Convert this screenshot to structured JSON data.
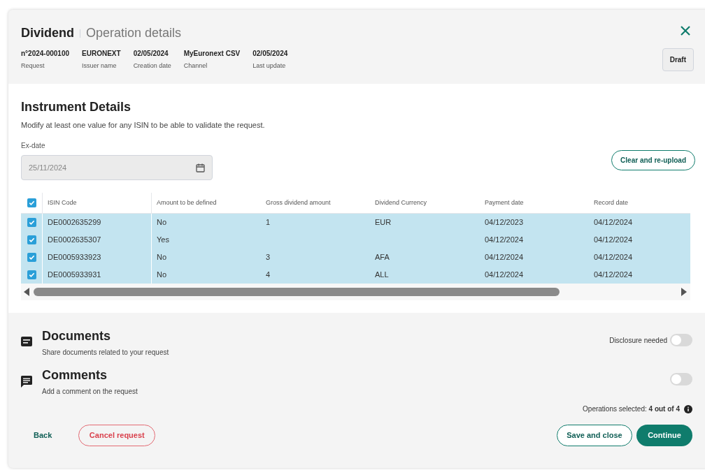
{
  "header": {
    "title": "Dividend",
    "subtitle": "Operation details",
    "status": "Draft",
    "meta": [
      {
        "value": "n°2024-000100",
        "label": "Request"
      },
      {
        "value": "EURONEXT",
        "label": "Issuer name"
      },
      {
        "value": "02/05/2024",
        "label": "Creation date"
      },
      {
        "value": "MyEuronext CSV",
        "label": "Channel"
      },
      {
        "value": "02/05/2024",
        "label": "Last update"
      }
    ]
  },
  "instrument": {
    "title": "Instrument Details",
    "description": "Modify at least one value for any ISIN to be able to validate the request.",
    "ex_date": {
      "label": "Ex-date",
      "value": "25/11/2024",
      "disabled": true
    },
    "clear_button": "Clear and re-upload"
  },
  "table": {
    "all_checked": true,
    "columns": [
      "ISIN Code",
      "Amount to be defined",
      "Gross dividend amount",
      "Dividend Currency",
      "Payment date",
      "Record date"
    ],
    "rows": [
      {
        "checked": true,
        "cells": [
          "DE0002635299",
          "No",
          "1",
          "EUR",
          "04/12/2023",
          "04/12/2024"
        ]
      },
      {
        "checked": true,
        "cells": [
          "DE0002635307",
          "Yes",
          "",
          "",
          "04/12/2024",
          "04/12/2024"
        ]
      },
      {
        "checked": true,
        "cells": [
          "DE0005933923",
          "No",
          "3",
          "AFA",
          "04/12/2024",
          "04/12/2024"
        ]
      },
      {
        "checked": true,
        "cells": [
          "DE0005933931",
          "No",
          "4",
          "ALL",
          "04/12/2024",
          "04/12/2024"
        ]
      }
    ]
  },
  "sections": [
    {
      "kind": "documents",
      "title": "Documents",
      "description": "Share documents related to your request",
      "toggle_label": "Disclosure needed",
      "on": false
    },
    {
      "kind": "comments",
      "title": "Comments",
      "description": "Add a comment on the request",
      "on": false
    }
  ],
  "operations_selected": "Operations selected: **4 out of 4**",
  "footer": {
    "back": "Back",
    "cancel": "Cancel request",
    "save": "Save and close",
    "continue": "Continue"
  }
}
